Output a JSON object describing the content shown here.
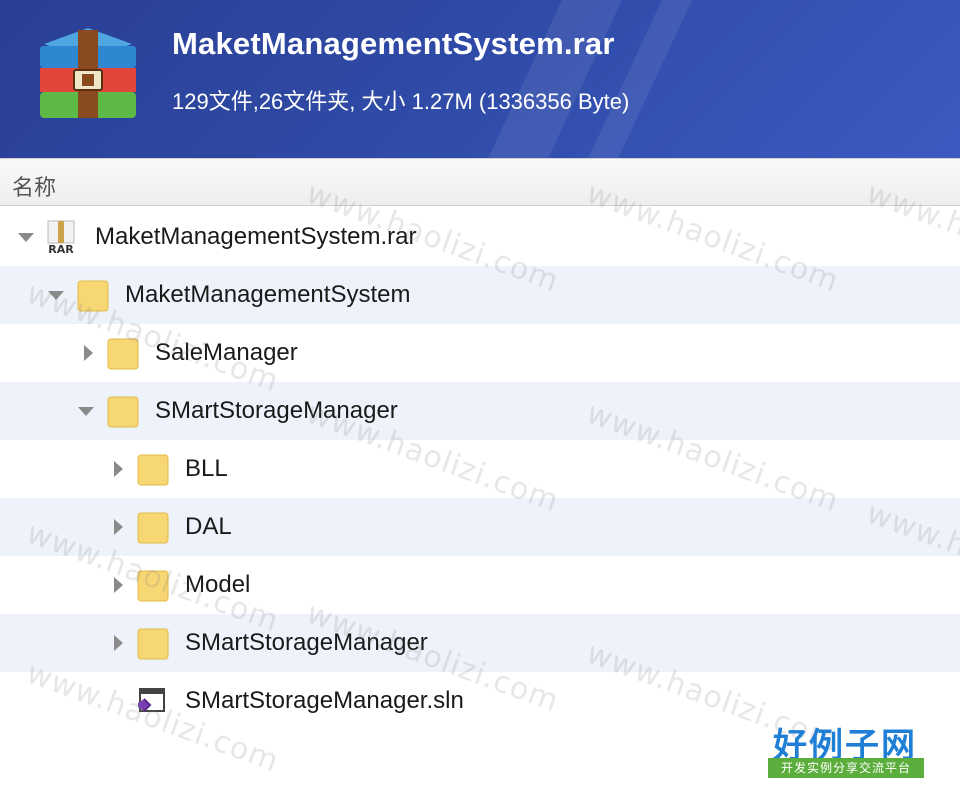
{
  "header": {
    "title": "MaketManagementSystem.rar",
    "subtitle": "129文件,26文件夹, 大小 1.27M (1336356 Byte)"
  },
  "column_header": {
    "name_label": "名称"
  },
  "tree": [
    {
      "label": "MaketManagementSystem.rar",
      "icon": "rar-archive-icon",
      "expanded": true
    },
    {
      "label": "MaketManagementSystem",
      "icon": "folder-icon",
      "expanded": true
    },
    {
      "label": "SaleManager",
      "icon": "folder-icon",
      "expanded": false
    },
    {
      "label": "SMartStorageManager",
      "icon": "folder-icon",
      "expanded": true
    },
    {
      "label": "BLL",
      "icon": "folder-icon",
      "expanded": false
    },
    {
      "label": "DAL",
      "icon": "folder-icon",
      "expanded": false
    },
    {
      "label": "Model",
      "icon": "folder-icon",
      "expanded": false
    },
    {
      "label": "SMartStorageManager",
      "icon": "folder-icon",
      "expanded": false
    },
    {
      "label": "SMartStorageManager.sln",
      "icon": "visual-studio-solution-icon"
    }
  ],
  "watermark": {
    "text": "www.haolizi.com"
  },
  "brand": {
    "name": "好例子网",
    "tagline": "开发实例分享交流平台"
  },
  "colors": {
    "header_bg": "#2f4aa6",
    "row_alt": "#eef3fb",
    "folder": "#f7d774",
    "brand_blue": "#1f7fd6",
    "brand_green": "#5cae3c"
  }
}
